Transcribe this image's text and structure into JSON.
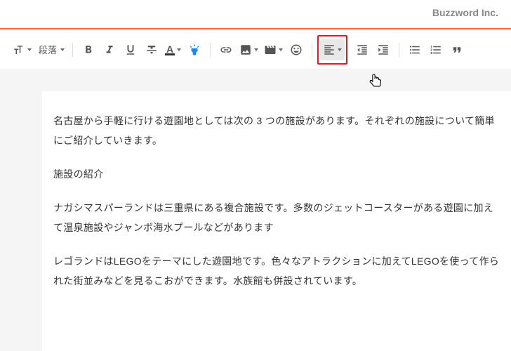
{
  "brand": "Buzzword Inc.",
  "toolbar": {
    "paragraph_label": "段落"
  },
  "content": {
    "p1": "名古屋から手軽に行ける遊園地としては次の 3 つの施設があります。それぞれの施設について簡単にご紹介していきます。",
    "p2": "施設の紹介",
    "p3": "ナガシマスパーランドは三重県にある複合施設です。多数のジェットコースターがある遊園に加えて温泉施設やジャンボ海水プールなどがあります",
    "p4": "レゴランドはLEGOをテーマにした遊園地です。色々なアトラクションに加えてLEGOを使って作られた街並みなどを見るこおができます。水族館も併設されています。"
  }
}
